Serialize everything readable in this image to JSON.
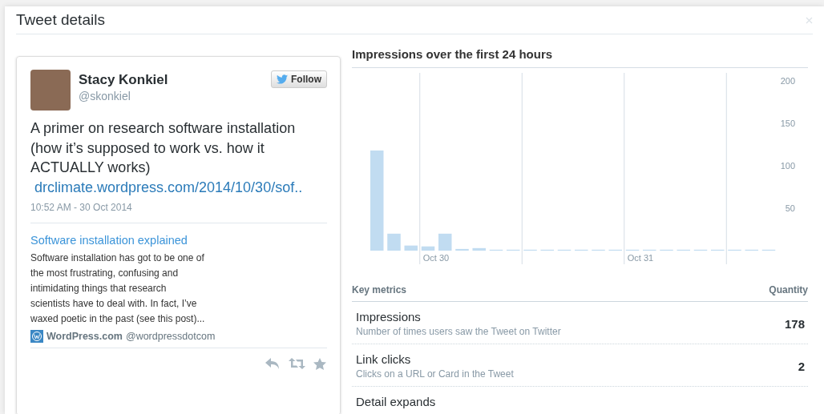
{
  "dialog": {
    "title": "Tweet details"
  },
  "tweet": {
    "author": {
      "name": "Stacy Konkiel",
      "handle": "@skonkiel"
    },
    "follow_button": {
      "label": "Follow"
    },
    "text": "A primer on research software installation (how it’s supposed to work vs. how it ACTUALLY works)",
    "link": "drclimate.wordpress.com/2014/10/30/sof..",
    "timestamp": "10:52 AM - 30 Oct 2014",
    "card": {
      "title": "Software installation explained",
      "description": "Software installation has got to be one of the most frustrating, confusing and intimidating things that research scientists have to deal with. In fact, I’ve waxed poetic in the past (see this post)...",
      "site_name": "WordPress.com",
      "site_handle": "@wordpressdotcom"
    }
  },
  "impressions_panel": {
    "title": "Impressions over the first 24 hours",
    "chart_data": {
      "type": "bar",
      "categories": [
        null,
        null,
        null,
        "Oct 30",
        null,
        null,
        null,
        null,
        null,
        null,
        null,
        null,
        null,
        null,
        null,
        "Oct 31",
        null,
        null,
        null,
        null,
        null,
        null,
        null,
        null
      ],
      "series": [
        {
          "color": "#c1dcf1",
          "values": [
            118,
            20,
            6,
            5,
            20,
            2,
            3,
            0,
            0,
            0,
            0,
            0,
            0,
            0,
            0,
            0,
            0,
            0,
            0,
            0,
            0,
            0,
            0,
            0
          ]
        }
      ],
      "ylim": [
        0,
        200
      ],
      "yticks": [
        50,
        100,
        150,
        200
      ],
      "grid": true
    }
  },
  "metrics": {
    "columns": [
      "Key metrics",
      "Quantity"
    ],
    "rows": [
      {
        "name": "Impressions",
        "description": "Number of times users saw the Tweet on Twitter",
        "quantity": "178"
      },
      {
        "name": "Link clicks",
        "description": "Clicks on a URL or Card in the Tweet",
        "quantity": "2"
      },
      {
        "name": "Detail expands"
      }
    ]
  }
}
